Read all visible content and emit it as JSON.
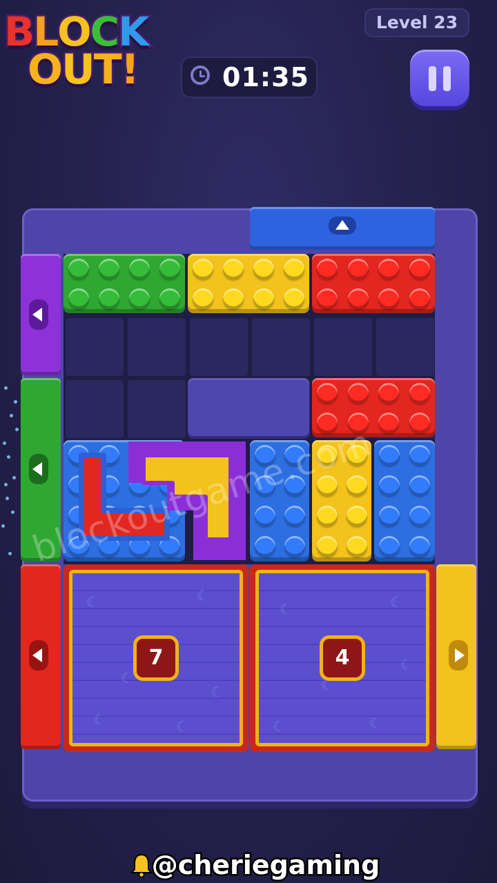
{
  "header": {
    "logo_line1": [
      "B",
      "L",
      "O",
      "C",
      "K"
    ],
    "logo_line2": [
      "O",
      "U",
      "T",
      "!"
    ],
    "logo_colors1": [
      "#e8322a",
      "#f4a11c",
      "#f6c21f",
      "#3cbd3a",
      "#2f9bea"
    ],
    "logo_colors2": [
      "#f6b21c",
      "#f6c21f",
      "#f6b21c",
      "#f6a41a"
    ],
    "level": "Level 23",
    "timer": "01:35"
  },
  "colors": {
    "green": "#2fa832",
    "yellow": "#f4c21d",
    "red": "#e3261f",
    "blue": "#2d6fe0",
    "purple": "#8a2fd8"
  },
  "board": {
    "pieces": [
      "green block",
      "yellow block",
      "red block",
      "red block",
      "blue block",
      "purple block",
      "blue block",
      "yellow block",
      "blue block"
    ],
    "gates": [
      "blue gate up",
      "purple gate left",
      "green gate left",
      "red gate left",
      "yellow gate right"
    ],
    "boxes": [
      {
        "count": "7"
      },
      {
        "count": "4"
      }
    ]
  },
  "watermark": "blockoutgame.com",
  "credit": "@cheriegaming",
  "icons": [
    "clock-icon",
    "pause-icon",
    "arrow-up-icon",
    "arrow-left-icon",
    "arrow-right-icon",
    "bell-icon"
  ]
}
